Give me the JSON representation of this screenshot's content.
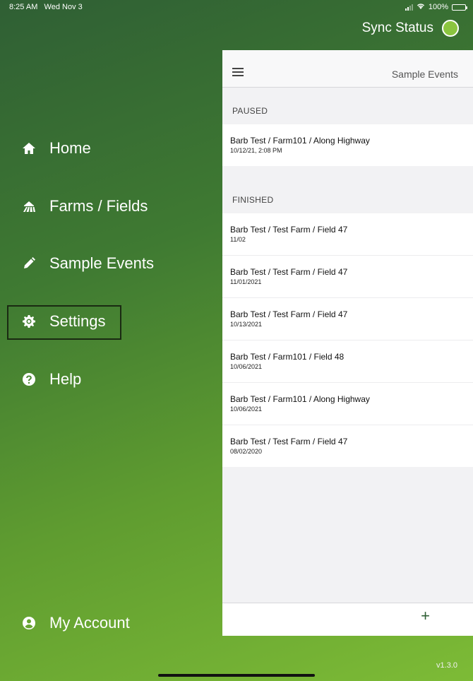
{
  "status_bar": {
    "time": "8:25 AM",
    "date": "Wed Nov 3",
    "battery": "100%"
  },
  "sync": {
    "label": "Sync Status",
    "color": "#8bc53f"
  },
  "nav": {
    "items": [
      {
        "label": "Home",
        "icon": "home-icon"
      },
      {
        "label": "Farms / Fields",
        "icon": "farm-field-icon"
      },
      {
        "label": "Sample Events",
        "icon": "pencil-icon"
      },
      {
        "label": "Settings",
        "icon": "gear-icon"
      },
      {
        "label": "Help",
        "icon": "help-icon"
      }
    ],
    "account": {
      "label": "My Account",
      "icon": "user-icon"
    }
  },
  "panel": {
    "title": "Sample Events",
    "paused_label": "PAUSED",
    "paused": [
      {
        "title": "Barb Test / Farm101 / Along Highway",
        "date": "10/12/21, 2:08 PM"
      }
    ],
    "finished_label": "FINISHED",
    "finished": [
      {
        "title": "Barb Test / Test Farm / Field 47",
        "date": "11/02"
      },
      {
        "title": "Barb Test / Test Farm / Field 47",
        "date": "11/01/2021"
      },
      {
        "title": "Barb Test / Test Farm / Field 47",
        "date": "10/13/2021"
      },
      {
        "title": "Barb Test / Farm101 / Field 48",
        "date": "10/06/2021"
      },
      {
        "title": "Barb Test / Farm101 / Along Highway",
        "date": "10/06/2021"
      },
      {
        "title": "Barb Test / Test Farm / Field 47",
        "date": "08/02/2020"
      }
    ],
    "add_label": "+"
  },
  "version": "v1.3.0",
  "colors": {
    "brand_dark": "#2f5f34",
    "brand_light": "#7dbb36"
  }
}
